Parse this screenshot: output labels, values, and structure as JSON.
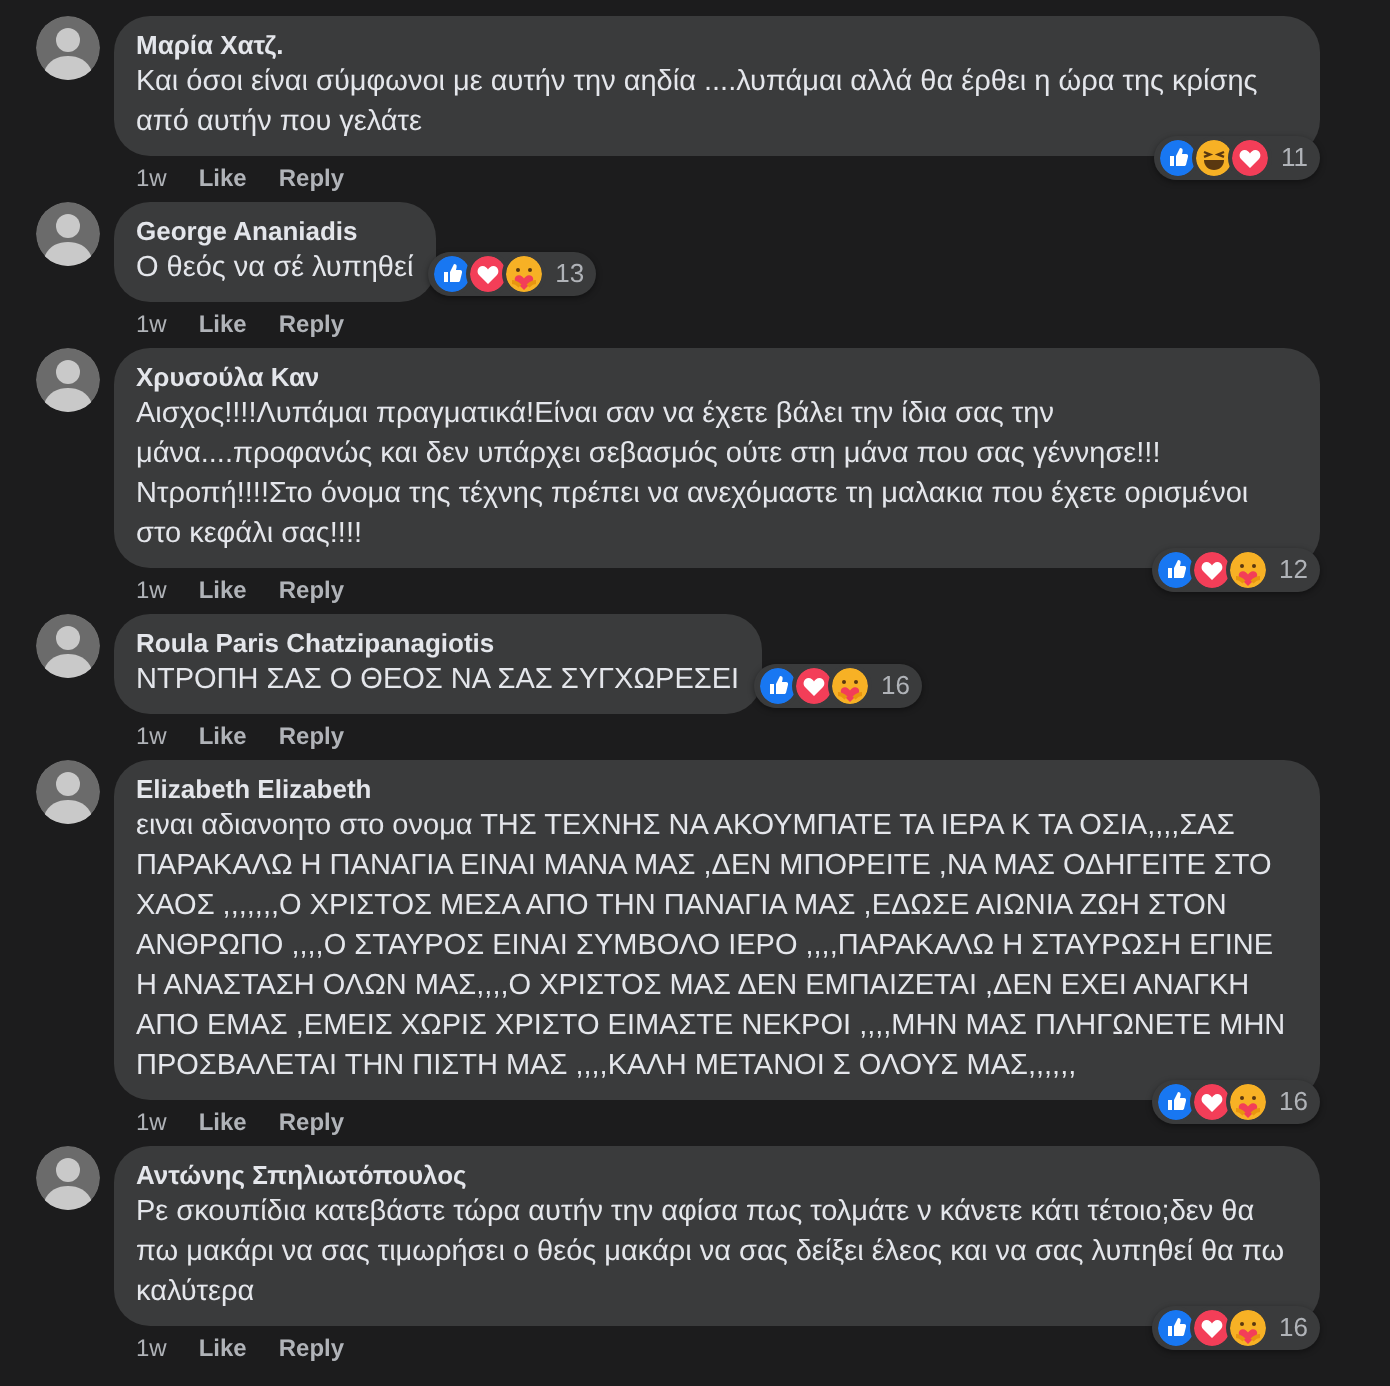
{
  "comments": [
    {
      "author": "Μαρία Χατζ.",
      "text": "Και όσοι είναι σύμφωνοι με αυτήν την αηδία ....λυπάμαι αλλά θα έρθει η ώρα της κρίσης από αυτήν που γελάτε",
      "reactions": [
        {
          "kind": "like"
        },
        {
          "kind": "haha"
        },
        {
          "kind": "love"
        }
      ],
      "reaction_count": "11",
      "time": "1w",
      "actions": [
        "Like",
        "Reply"
      ]
    },
    {
      "author": "George Ananiadis",
      "text": "Ο θεός να σέ λυπηθεί",
      "reactions": [
        {
          "kind": "like"
        },
        {
          "kind": "love"
        },
        {
          "kind": "care"
        }
      ],
      "reaction_count": "13",
      "time": "1w",
      "actions": [
        "Like",
        "Reply"
      ]
    },
    {
      "author": "Χρυσούλα Καν",
      "text": "Αισχος!!!!Λυπάμαι πραγματικά!Είναι σαν να έχετε βάλει την ίδια σας την μάνα....προφανώς και δεν υπάρχει σεβασμός ούτε στη μάνα που σας γέννησε!!! Ντροπή!!!!Στο όνομα της τέχνης πρέπει να ανεχόμαστε τη μαλακια που έχετε ορισμένοι στο κεφάλι σας!!!!",
      "reactions": [
        {
          "kind": "like"
        },
        {
          "kind": "love"
        },
        {
          "kind": "care"
        }
      ],
      "reaction_count": "12",
      "time": "1w",
      "actions": [
        "Like",
        "Reply"
      ]
    },
    {
      "author": "Roula Paris Chatzipanagiotis",
      "text": "ΝΤΡΟΠΗ ΣΑΣ Ο ΘΕΟΣ ΝΑ ΣΑΣ ΣΥΓΧΩΡΕΣΕΙ",
      "reactions": [
        {
          "kind": "like"
        },
        {
          "kind": "love"
        },
        {
          "kind": "care"
        }
      ],
      "reaction_count": "16",
      "time": "1w",
      "actions": [
        "Like",
        "Reply"
      ]
    },
    {
      "author": "Elizabeth Elizabeth",
      "text": "ειναι αδιανοητο στο ονομα ΤΗΣ ΤΕΧΝΗΣ ΝΑ ΑΚΟΥΜΠΑΤΕ ΤΑ ΙΕΡΑ Κ ΤΑ ΟΣΙΑ,,,,ΣΑΣ ΠΑΡΑΚΑΛΩ Η ΠΑΝΑΓΙΑ ΕΙΝΑΙ ΜΑΝΑ ΜΑΣ ,ΔΕΝ ΜΠΟΡΕΙΤΕ ,ΝΑ ΜΑΣ ΟΔΗΓΕΙΤΕ ΣΤΟ ΧΑΟΣ ,,,,,,,Ο ΧΡΙΣΤΟΣ ΜΕΣΑ ΑΠΟ ΤΗΝ ΠΑΝΑΓΙΑ ΜΑΣ ,ΕΔΩΣΕ ΑΙΩΝΙΑ ΖΩΗ ΣΤΟΝ ΑΝΘΡΩΠΟ ,,,,Ο ΣΤΑΥΡΟΣ ΕΙΝΑΙ ΣΥΜΒΟΛΟ ΙΕΡΟ ,,,,ΠΑΡΑΚΑΛΩ Η ΣΤΑΥΡΩΣΗ ΕΓΙΝΕ Η ΑΝΑΣΤΑΣΗ ΟΛΩΝ ΜΑΣ,,,,Ο ΧΡΙΣΤΟΣ ΜΑΣ ΔΕΝ ΕΜΠΑΙΖΕΤΑΙ ,ΔΕΝ ΕΧΕΙ ΑΝΑΓΚΗ ΑΠΟ ΕΜΑΣ ,ΕΜΕΙΣ ΧΩΡΙΣ ΧΡΙΣΤΟ ΕΙΜΑΣΤΕ ΝΕΚΡΟΙ ,,,,ΜΗΝ ΜΑΣ ΠΛΗΓΩΝΕΤΕ ΜΗΝ ΠΡΟΣΒΑΛΕΤΑΙ ΤΗΝ ΠΙΣΤΗ ΜΑΣ ,,,,ΚΑΛΗ ΜΕΤΑΝΟΙ Σ ΟΛΟΥΣ ΜΑΣ,,,,,,",
      "reactions": [
        {
          "kind": "like"
        },
        {
          "kind": "love"
        },
        {
          "kind": "care"
        }
      ],
      "reaction_count": "16",
      "time": "1w",
      "actions": [
        "Like",
        "Reply"
      ]
    },
    {
      "author": "Αντώνης Σπηλιωτόπουλος",
      "text": "Ρε σκουπίδια κατεβάστε τώρα αυτήν την αφίσα πως τολμάτε ν κάνετε κάτι τέτοιο;δεν θα πω μακάρι να σας τιμωρήσει ο θεός μακάρι να σας δείξει έλεος και να σας λυπηθεί θα πω καλύτερα",
      "reactions": [
        {
          "kind": "like"
        },
        {
          "kind": "love"
        },
        {
          "kind": "care"
        }
      ],
      "reaction_count": "16",
      "time": "1w",
      "actions": [
        "Like",
        "Reply"
      ]
    }
  ]
}
